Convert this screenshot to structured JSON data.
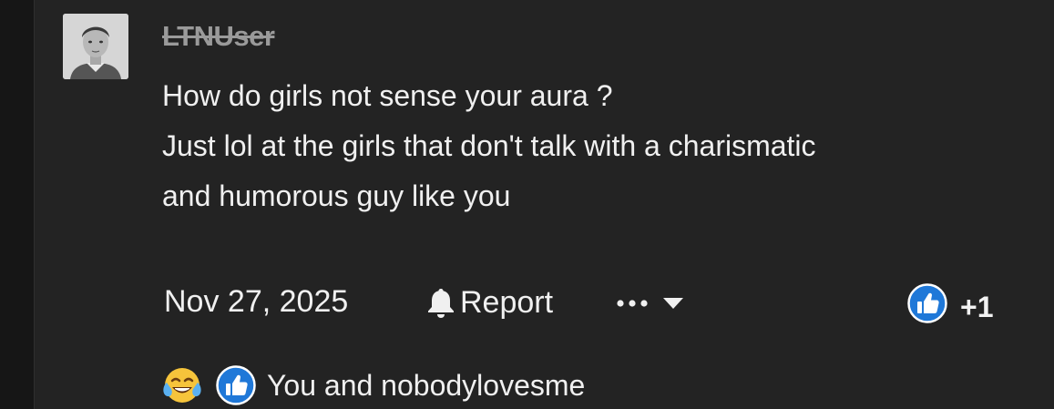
{
  "post": {
    "username": "LTNUser",
    "message_lines": [
      "How do girls not sense your aura ?",
      "Just lol at the girls that don't talk with a charismatic",
      "and humorous guy like you"
    ],
    "date": "Nov 27, 2025",
    "report_label": "Report",
    "reaction_count": "+1",
    "reactions_text": "You and nobodylovesme"
  },
  "icons": {
    "avatar": "user-avatar-photo",
    "report": "bell-icon",
    "more": "ellipsis-icon",
    "dropdown": "chevron-down-icon",
    "like": "thumbs-up-icon",
    "laugh": "tears-of-joy-emoji"
  },
  "colors": {
    "background": "#232323",
    "text": "#f0f0f0",
    "username_struck": "#9a9a9a",
    "like_blue": "#1f78d8"
  }
}
